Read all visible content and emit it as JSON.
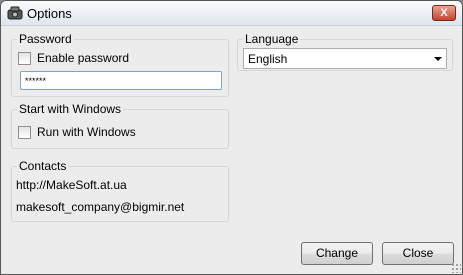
{
  "window": {
    "title": "Options",
    "close_glyph": "X",
    "icon": "app-icon"
  },
  "password": {
    "group_label": "Password",
    "enable_label": "Enable password",
    "enable_checked": false,
    "value": "******"
  },
  "startup": {
    "group_label": "Start with Windows",
    "run_label": "Run with Windows",
    "run_checked": false
  },
  "contacts": {
    "group_label": "Contacts",
    "website": "http://MakeSoft.at.ua",
    "email": "makesoft_company@bigmir.net"
  },
  "language": {
    "group_label": "Language",
    "selected": "English"
  },
  "buttons": {
    "change": "Change",
    "close": "Close"
  },
  "colors": {
    "close_button": "#c4452d",
    "input_border": "#7da2ce",
    "window_bg": "#ececec"
  }
}
